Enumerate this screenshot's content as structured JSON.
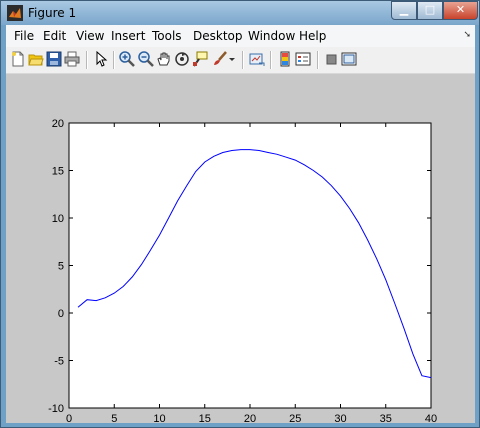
{
  "window": {
    "title": "Figure 1",
    "minimize_icon": "minimize-icon",
    "maximize_icon": "maximize-icon",
    "close_icon": "close-icon"
  },
  "menu": {
    "items": [
      "File",
      "Edit",
      "View",
      "Insert",
      "Tools",
      "Desktop",
      "Window",
      "Help"
    ],
    "dock_arrow": "dock-arrow-icon"
  },
  "toolbar": {
    "icons": [
      "new-figure-icon",
      "open-file-icon",
      "save-icon",
      "print-icon",
      "edit-plot-icon",
      "zoom-in-icon",
      "zoom-out-icon",
      "pan-icon",
      "rotate-3d-icon",
      "data-cursor-icon",
      "brush-icon",
      "link-plot-icon",
      "insert-colorbar-icon",
      "insert-legend-icon",
      "hide-plot-tools-icon",
      "show-plot-tools-icon"
    ]
  },
  "colors": {
    "plot_line": "#0000ff",
    "figure_bg": "#c8c8c8",
    "axes_bg": "#ffffff"
  },
  "chart_data": {
    "type": "line",
    "title": "",
    "xlabel": "",
    "ylabel": "",
    "xlim": [
      0,
      40
    ],
    "ylim": [
      -10,
      20
    ],
    "xticks": [
      0,
      5,
      10,
      15,
      20,
      25,
      30,
      35,
      40
    ],
    "yticks": [
      -10,
      -5,
      0,
      5,
      10,
      15,
      20
    ],
    "grid": false,
    "series": [
      {
        "color": "#0000ff",
        "x": [
          1,
          2,
          3,
          4,
          5,
          6,
          7,
          8,
          9,
          10,
          11,
          12,
          13,
          14,
          15,
          16,
          17,
          18,
          19,
          20,
          21,
          22,
          23,
          24,
          25,
          26,
          27,
          28,
          29,
          30,
          31,
          32,
          33,
          34,
          35,
          36,
          37,
          38,
          39,
          40
        ],
        "y": [
          0.6,
          1.4,
          1.3,
          1.6,
          2.1,
          2.8,
          3.8,
          5.1,
          6.6,
          8.2,
          10.0,
          11.8,
          13.4,
          14.9,
          15.9,
          16.5,
          16.9,
          17.1,
          17.2,
          17.2,
          17.1,
          16.9,
          16.7,
          16.4,
          16.1,
          15.6,
          15.0,
          14.3,
          13.4,
          12.3,
          11.0,
          9.5,
          7.7,
          5.7,
          3.5,
          1.0,
          -1.6,
          -4.3,
          -6.6,
          -6.8
        ]
      }
    ]
  }
}
